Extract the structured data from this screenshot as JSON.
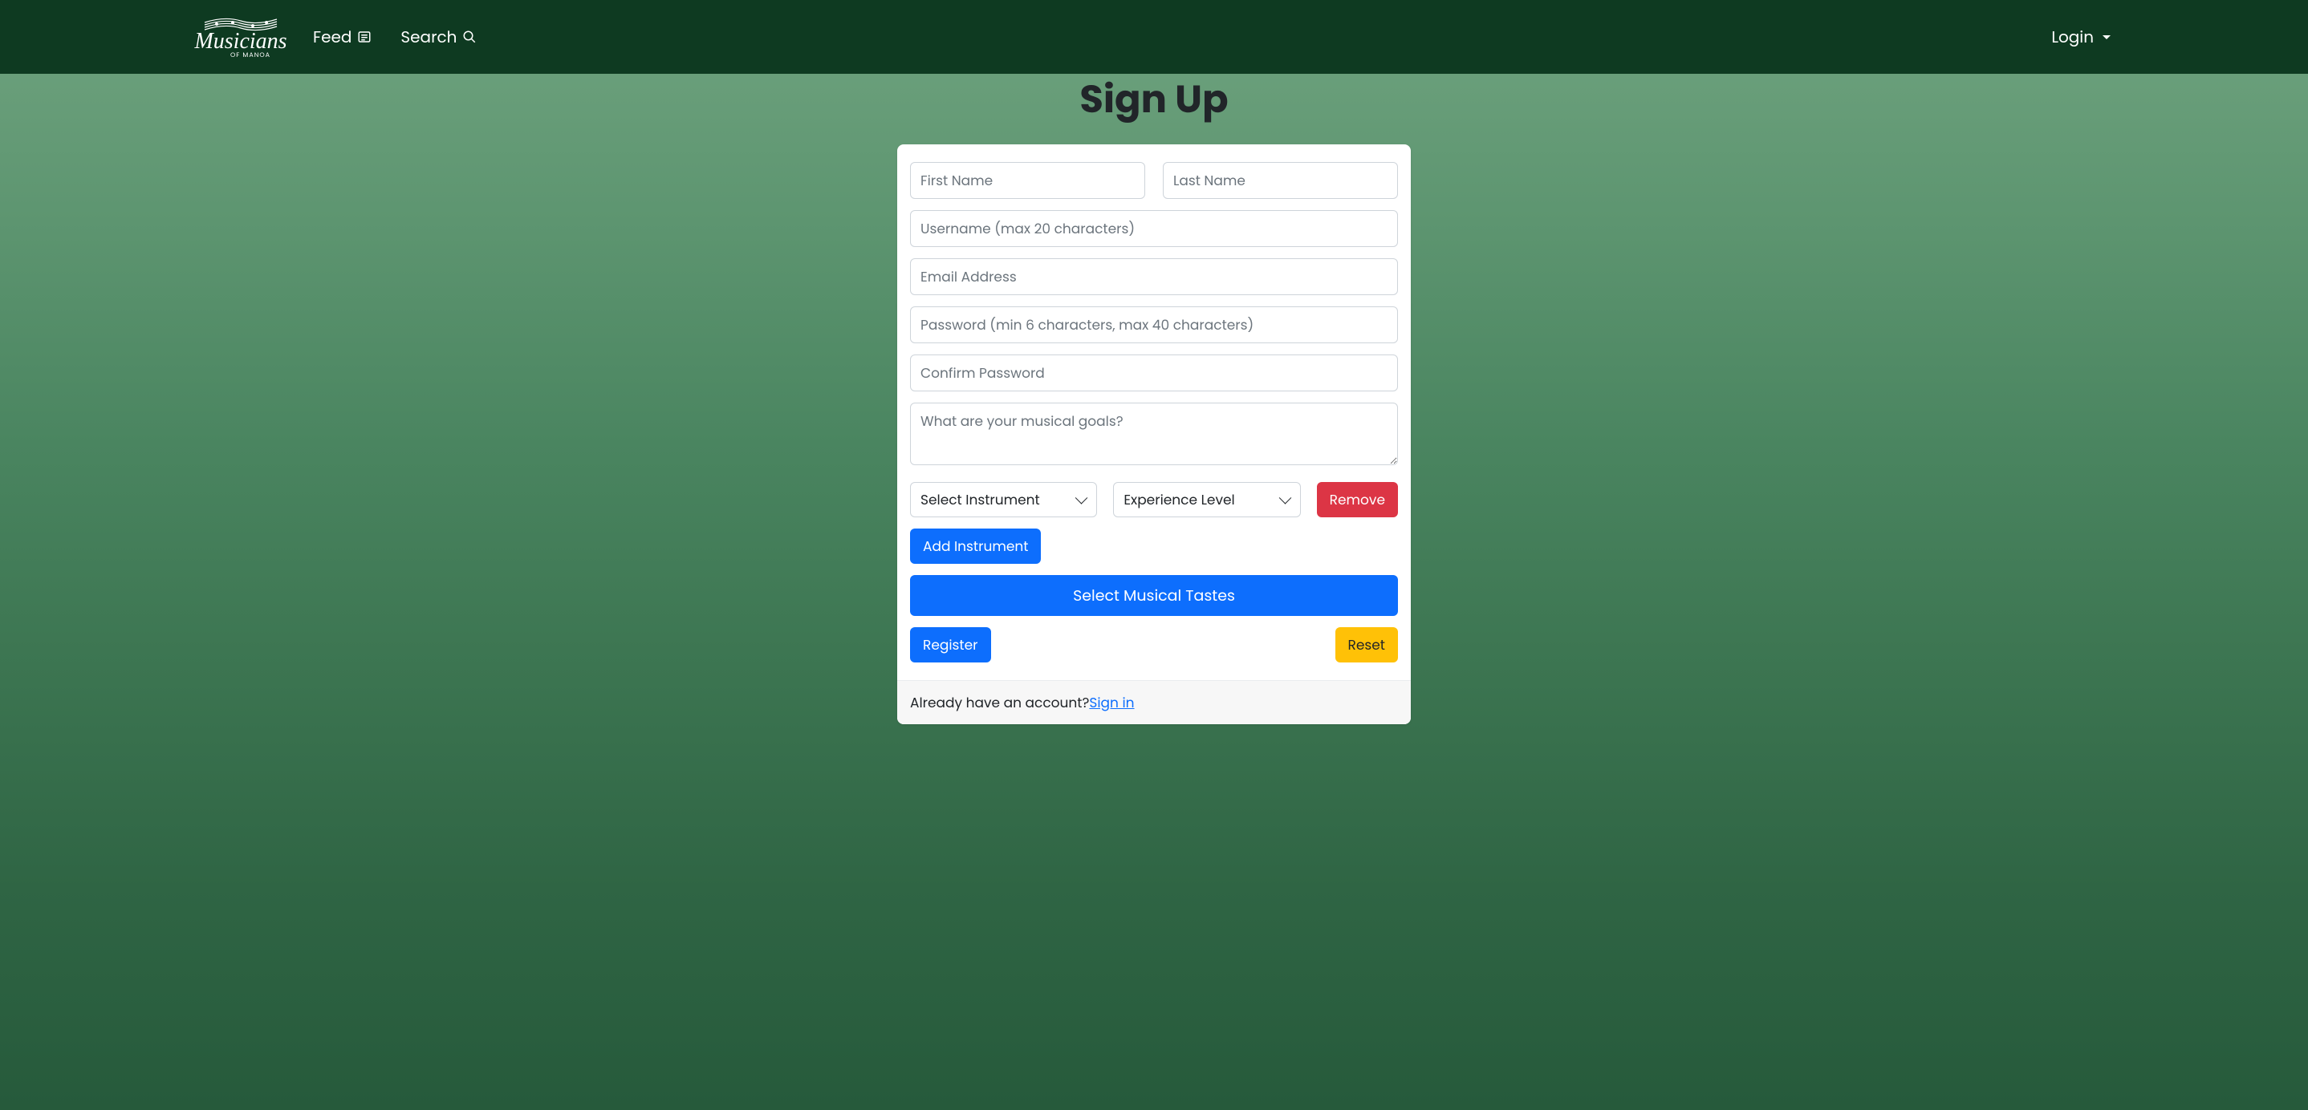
{
  "nav": {
    "brand_main": "Musicians",
    "brand_sub": "OF MANOA",
    "feed": "Feed",
    "search": "Search",
    "login": "Login"
  },
  "page": {
    "title": "Sign Up"
  },
  "form": {
    "first_name_ph": "First Name",
    "last_name_ph": "Last Name",
    "username_ph": "Username (max 20 characters)",
    "email_ph": "Email Address",
    "password_ph": "Password (min 6 characters, max 40 characters)",
    "confirm_ph": "Confirm Password",
    "goals_ph": "What are your musical goals?",
    "instrument_default": "Select Instrument",
    "experience_default": "Experience Level",
    "remove_btn": "Remove",
    "add_instrument_btn": "Add Instrument",
    "select_tastes_btn": "Select Musical Tastes",
    "register_btn": "Register",
    "reset_btn": "Reset"
  },
  "footer": {
    "prompt": "Already have an account?",
    "link": "Sign in"
  }
}
